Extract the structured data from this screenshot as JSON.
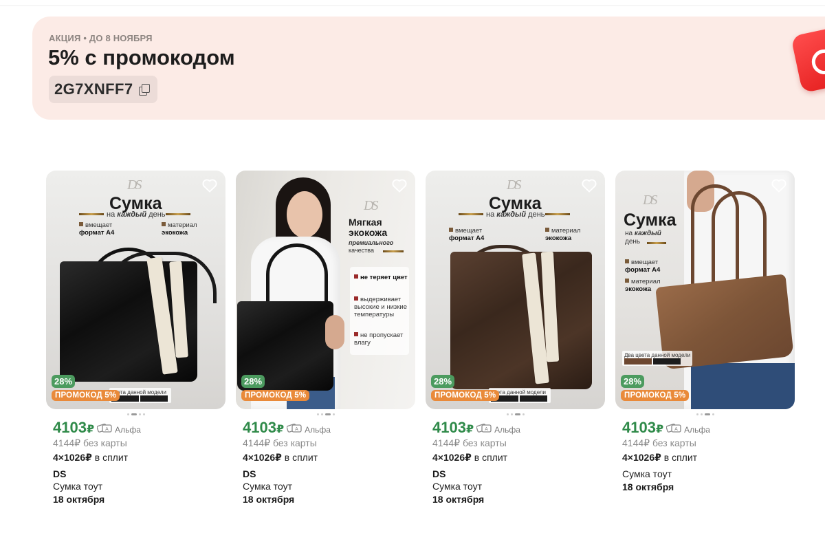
{
  "promo": {
    "tag": "АКЦИЯ • ДО 8 НОЯБРЯ",
    "title": "5% с промокодом",
    "code": "2G7XNFF7"
  },
  "products": [
    {
      "image": {
        "headline": "Сумка",
        "subline_prefix": "на",
        "subline_em": "каждый",
        "subline_suffix": "день",
        "feature1_line1": "вмещает",
        "feature1_line2": "формат А4",
        "feature2_line1": "материал",
        "feature2_line2": "экокожа",
        "swatch_label": "цвета данной модели"
      },
      "discount": "28%",
      "promo_badge": "ПРОМОКОД 5%",
      "price": "4103",
      "currency": "₽",
      "bank": "Альфа",
      "old_price": "4144₽ без карты",
      "split_amount": "4×1026₽",
      "split_label": "в сплит",
      "brand": "DS",
      "title": "Сумка тоут",
      "delivery": "18 октября"
    },
    {
      "image": {
        "headline": "Мягкая экокожа",
        "headline_line1": "Мягкая",
        "headline_line2": "экокожа",
        "subline_em": "премиального",
        "subline_suffix": "качества",
        "benefit1": "не теряет цвет",
        "benefit2": "выдерживает высокие и низкие температуры",
        "benefit3": "не пропускает влагу"
      },
      "discount": "28%",
      "promo_badge": "ПРОМОКОД 5%",
      "price": "4103",
      "currency": "₽",
      "bank": "Альфа",
      "old_price": "4144₽ без карты",
      "split_amount": "4×1026₽",
      "split_label": "в сплит",
      "brand": "DS",
      "title": "Сумка тоут",
      "delivery": "18 октября"
    },
    {
      "image": {
        "headline": "Сумка",
        "subline_prefix": "на",
        "subline_em": "каждый",
        "subline_suffix": "день",
        "feature1_line1": "вмещает",
        "feature1_line2": "формат А4",
        "feature2_line1": "материал",
        "feature2_line2": "экокожа",
        "swatch_label": "цвета данной модели"
      },
      "discount": "28%",
      "promo_badge": "ПРОМОКОД 5%",
      "price": "4103",
      "currency": "₽",
      "bank": "Альфа",
      "old_price": "4144₽ без карты",
      "split_amount": "4×1026₽",
      "split_label": "в сплит",
      "brand": "DS",
      "title": "Сумка тоут",
      "delivery": "18 октября"
    },
    {
      "image": {
        "headline": "Сумка",
        "subline_prefix": "на",
        "subline_em": "каждый",
        "subline_suffix": "день",
        "feature1_line1": "вмещает",
        "feature1_line2": "формат А4",
        "feature2_line1": "материал",
        "feature2_line2": "экокожа",
        "swatch_label": "Два цвета данной модели"
      },
      "discount": "28%",
      "promo_badge": "ПРОМОКОД 5%",
      "price": "4103",
      "currency": "₽",
      "bank": "Альфа",
      "old_price": "4144₽ без карты",
      "split_amount": "4×1026₽",
      "split_label": "в сплит",
      "brand": "",
      "title": "Сумка тоут",
      "delivery": "18 октября"
    }
  ],
  "colors": {
    "price_green": "#2f8a49",
    "discount_green": "#4c9b5f",
    "promo_orange": "#e98a3a",
    "banner_bg": "#fcebe6"
  }
}
